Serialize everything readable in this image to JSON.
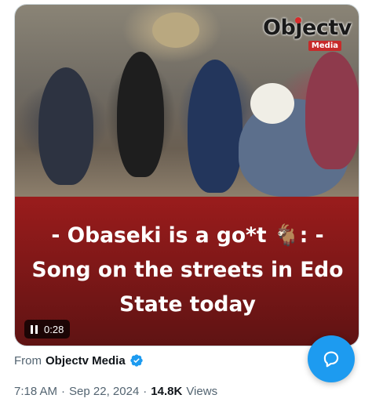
{
  "media": {
    "watermark": {
      "brand": "Objectv",
      "tag": "Media"
    },
    "headline": "- Obaseki is a go*t 🐐: - Song on the streets in Edo State today",
    "duration": "0:28"
  },
  "source": {
    "prefix": "From",
    "author": "Objectv Media",
    "verified_icon": "verified-badge-icon",
    "verified_color": "#1d9bf0"
  },
  "meta": {
    "time": "7:18 AM",
    "separator": "·",
    "date": "Sep 22, 2024",
    "views_count": "14.8K",
    "views_label": "Views"
  },
  "fab": {
    "icon": "compose-reply-icon",
    "color": "#1d9bf0"
  },
  "colors": {
    "headline_panel": "#8a1a1a",
    "secondary_text": "#536471",
    "primary_text": "#0f1419"
  }
}
